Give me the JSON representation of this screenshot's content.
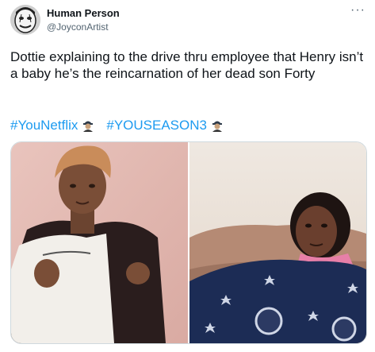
{
  "author": {
    "display_name": "Human Person",
    "handle": "@JoyconArtist",
    "avatar_icon": "mime-face-avatar-icon"
  },
  "menu_icon": "more-horizontal-icon",
  "menu_glyph": "···",
  "tweet": {
    "text": "Dottie explaining to the drive thru employee that Henry isn’t a baby he’s the reincarnation of her dead son Forty",
    "hashtags": [
      {
        "label": "#YouNetflix",
        "emoji_icon": "you-hashtag-emoji-icon"
      },
      {
        "label": "#YOUSEASON3",
        "emoji_icon": "you-hashtag-emoji-icon"
      }
    ]
  },
  "media": {
    "images": [
      {
        "name": "meme-image-young-woman-explaining"
      },
      {
        "name": "meme-image-woman-on-couch"
      }
    ]
  },
  "colors": {
    "text": "#0f1419",
    "secondary_text": "#536471",
    "link": "#1d9bf0",
    "border": "#cfd9de",
    "background": "#ffffff"
  }
}
